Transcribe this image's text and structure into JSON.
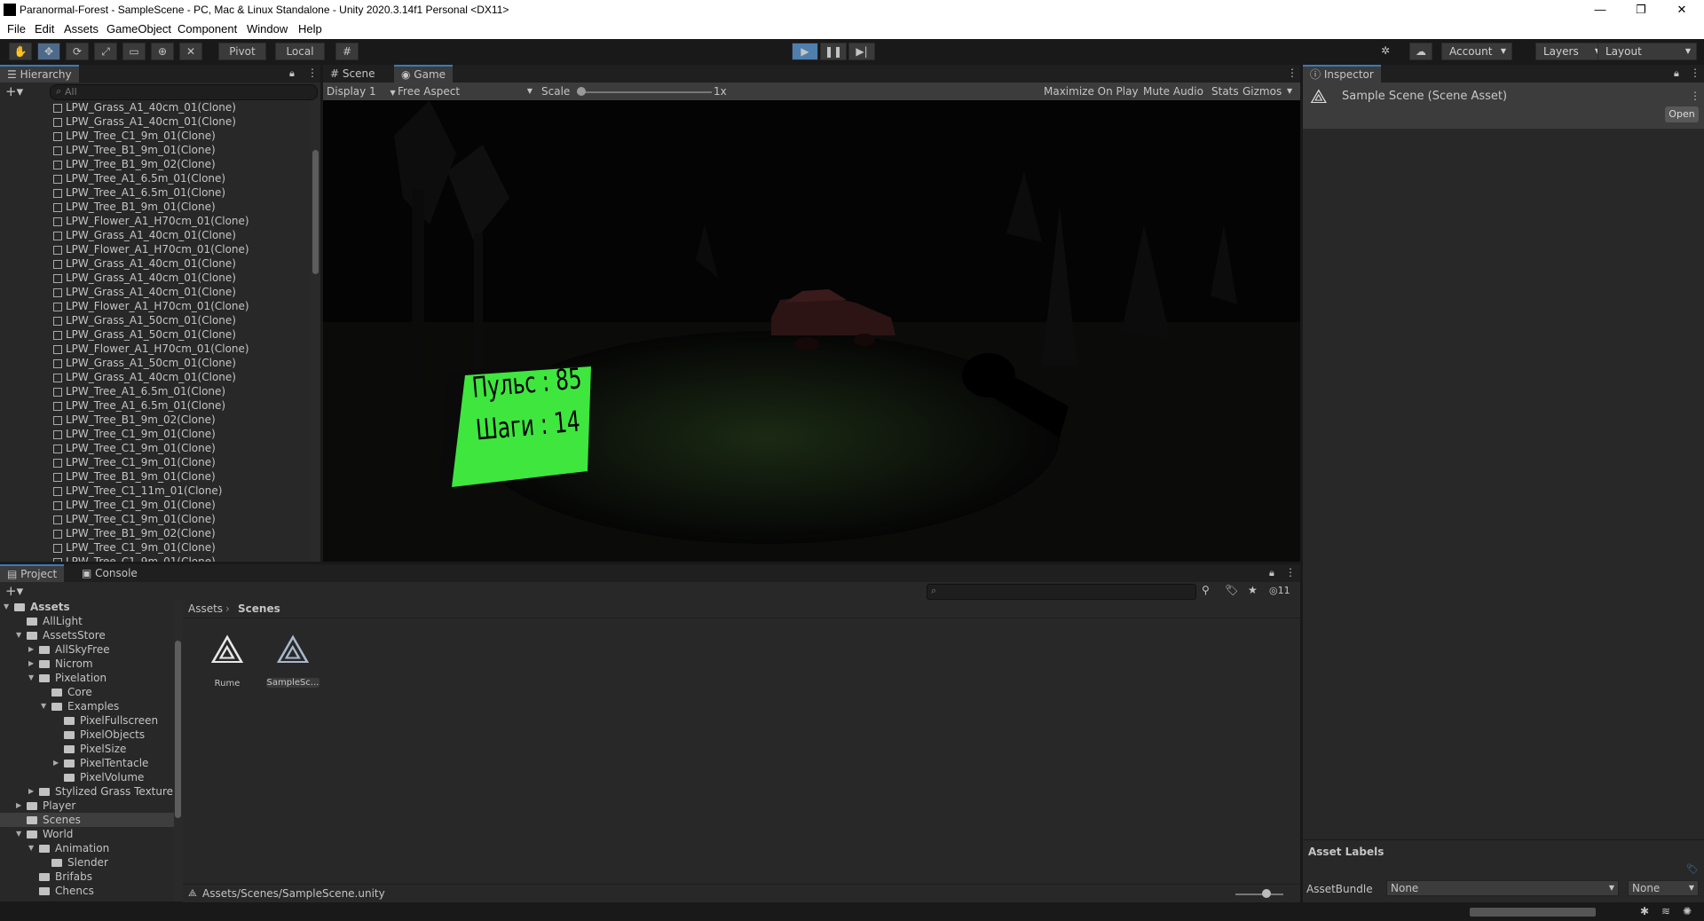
{
  "window": {
    "title": "Paranormal-Forest - SampleScene - PC, Mac & Linux Standalone - Unity 2020.3.14f1 Personal <DX11>",
    "minimize": "—",
    "maximize": "❐",
    "close": "✕"
  },
  "menu": [
    "File",
    "Edit",
    "Assets",
    "GameObject",
    "Component",
    "Window",
    "Help"
  ],
  "toolbar": {
    "pivot": "Pivot",
    "local": "Local",
    "account": "Account",
    "layers": "Layers",
    "layout": "Layout"
  },
  "hierarchy": {
    "tab": "Hierarchy",
    "search_placeholder": "All",
    "items": [
      "LPW_Grass_A1_40cm_01(Clone)",
      "LPW_Grass_A1_40cm_01(Clone)",
      "LPW_Tree_C1_9m_01(Clone)",
      "LPW_Tree_B1_9m_01(Clone)",
      "LPW_Tree_B1_9m_02(Clone)",
      "LPW_Tree_A1_6.5m_01(Clone)",
      "LPW_Tree_A1_6.5m_01(Clone)",
      "LPW_Tree_B1_9m_01(Clone)",
      "LPW_Flower_A1_H70cm_01(Clone)",
      "LPW_Grass_A1_40cm_01(Clone)",
      "LPW_Flower_A1_H70cm_01(Clone)",
      "LPW_Grass_A1_40cm_01(Clone)",
      "LPW_Grass_A1_40cm_01(Clone)",
      "LPW_Grass_A1_40cm_01(Clone)",
      "LPW_Flower_A1_H70cm_01(Clone)",
      "LPW_Grass_A1_50cm_01(Clone)",
      "LPW_Grass_A1_50cm_01(Clone)",
      "LPW_Flower_A1_H70cm_01(Clone)",
      "LPW_Grass_A1_50cm_01(Clone)",
      "LPW_Grass_A1_40cm_01(Clone)",
      "LPW_Tree_A1_6.5m_01(Clone)",
      "LPW_Tree_A1_6.5m_01(Clone)",
      "LPW_Tree_B1_9m_02(Clone)",
      "LPW_Tree_C1_9m_01(Clone)",
      "LPW_Tree_C1_9m_01(Clone)",
      "LPW_Tree_C1_9m_01(Clone)",
      "LPW_Tree_B1_9m_01(Clone)",
      "LPW_Tree_C1_11m_01(Clone)",
      "LPW_Tree_C1_9m_01(Clone)",
      "LPW_Tree_C1_9m_01(Clone)",
      "LPW_Tree_B1_9m_02(Clone)",
      "LPW_Tree_C1_9m_01(Clone)",
      "LPW_Tree_C1_9m_01(Clone)"
    ]
  },
  "game": {
    "tab_scene": "Scene",
    "tab_game": "Game",
    "display": "Display 1",
    "aspect": "Free Aspect",
    "scale_label": "Scale",
    "scale_value": "1x",
    "maximize": "Maximize On Play",
    "mute": "Mute Audio",
    "stats": "Stats",
    "gizmos": "Gizmos",
    "hud_line1": "Пульс : 85",
    "hud_line2": "Шаги : 14"
  },
  "inspector": {
    "tab": "Inspector",
    "asset_title": "Sample Scene (Scene Asset)",
    "open": "Open",
    "labels_header": "Asset Labels",
    "bundle_label": "AssetBundle",
    "bundle_value": "None",
    "variant_value": "None"
  },
  "project": {
    "tab_project": "Project",
    "tab_console": "Console",
    "hidden_count": "11",
    "breadcrumb_root": "Assets",
    "breadcrumb_current": "Scenes",
    "tree": [
      {
        "label": "Assets",
        "indent": 0,
        "expand": "open",
        "bold": true
      },
      {
        "label": "AllLight",
        "indent": 1,
        "expand": ""
      },
      {
        "label": "AssetsStore",
        "indent": 1,
        "expand": "open"
      },
      {
        "label": "AllSkyFree",
        "indent": 2,
        "expand": "closed"
      },
      {
        "label": "Nicrom",
        "indent": 2,
        "expand": "closed"
      },
      {
        "label": "Pixelation",
        "indent": 2,
        "expand": "open"
      },
      {
        "label": "Core",
        "indent": 3,
        "expand": ""
      },
      {
        "label": "Examples",
        "indent": 3,
        "expand": "open"
      },
      {
        "label": "PixelFullscreen",
        "indent": 4,
        "expand": ""
      },
      {
        "label": "PixelObjects",
        "indent": 4,
        "expand": ""
      },
      {
        "label": "PixelSize",
        "indent": 4,
        "expand": ""
      },
      {
        "label": "PixelTentacle",
        "indent": 4,
        "expand": "closed"
      },
      {
        "label": "PixelVolume",
        "indent": 4,
        "expand": ""
      },
      {
        "label": "Stylized Grass Texture",
        "indent": 2,
        "expand": "closed"
      },
      {
        "label": "Player",
        "indent": 1,
        "expand": "closed"
      },
      {
        "label": "Scenes",
        "indent": 1,
        "expand": "",
        "selected": true
      },
      {
        "label": "World",
        "indent": 1,
        "expand": "open"
      },
      {
        "label": "Animation",
        "indent": 2,
        "expand": "open"
      },
      {
        "label": "Slender",
        "indent": 3,
        "expand": ""
      },
      {
        "label": "Brifabs",
        "indent": 2,
        "expand": ""
      },
      {
        "label": "Chencs",
        "indent": 2,
        "expand": ""
      }
    ],
    "assets": [
      "Rume",
      "SampleSc..."
    ],
    "footer_path": "Assets/Scenes/SampleScene.unity"
  },
  "colors": {
    "accent": "#3a79bb",
    "hud_green": "#3ee63e",
    "play_blue": "#4e7fae"
  }
}
